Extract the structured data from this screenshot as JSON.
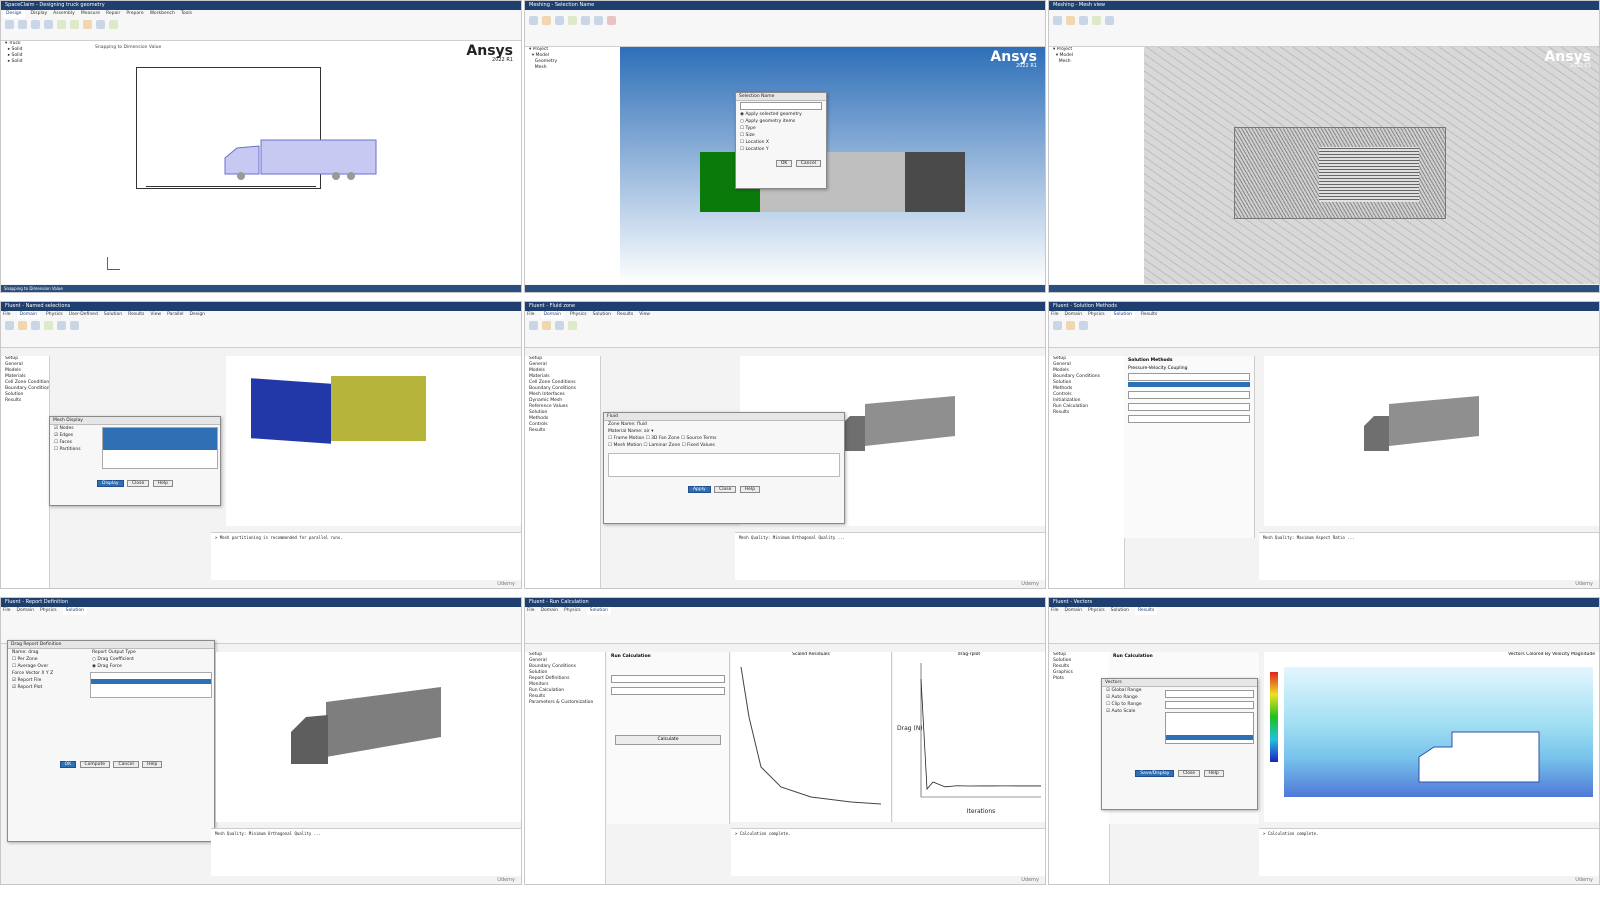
{
  "brand": {
    "name": "Ansys",
    "version": "2022 R1",
    "watermark": "Udemy"
  },
  "colors": {
    "title_bar": "#1f3f6f",
    "status_bar": "#2b4e7d",
    "selection": "#2f6fb3",
    "green_face": "#0a7a0a",
    "blue_face": "#2238a8",
    "yellow_face": "#b6b43a"
  },
  "panels": [
    {
      "id": "p1",
      "label": "SpaceClaim - Designing truck geometry",
      "status": "Snapping to Dimension Value",
      "viewport_text": "Snapping to Dimension Value"
    },
    {
      "id": "p2",
      "label": "Meshing - Selection Name",
      "dialog_title": "Selection Name",
      "dialog_ok": "OK",
      "dialog_cancel": "Cancel"
    },
    {
      "id": "p3",
      "label": "Meshing - Mesh view"
    },
    {
      "id": "p4",
      "label": "Fluent - Named selections",
      "dialog_title": "Mesh Display",
      "button_display": "Display",
      "button_close": "Close",
      "button_help": "Help"
    },
    {
      "id": "p5",
      "label": "Fluent - Fluid zone",
      "dialog_title": "Fluid",
      "button_apply": "Apply",
      "button_close": "Close",
      "button_help": "Help"
    },
    {
      "id": "p6",
      "label": "Fluent - Solution Methods",
      "panel_title": "Solution Methods",
      "item_coupling": "Pressure-Velocity Coupling"
    },
    {
      "id": "p7",
      "label": "Fluent - Report Definition",
      "dialog_title": "Drag Report Definition",
      "button_ok": "OK",
      "button_compute": "Compute",
      "button_cancel": "Cancel",
      "button_help": "Help"
    },
    {
      "id": "p8",
      "label": "Fluent - Run Calculation",
      "panel_title": "Run Calculation",
      "chart_left_title": "Scaled Residuals",
      "chart_right_title": "drag-rplot",
      "button_calculate": "Calculate"
    },
    {
      "id": "p9",
      "label": "Fluent - Vectors",
      "panel_title": "Run Calculation",
      "dialog_title": "Vectors",
      "viewport_title": "Vectors Colored By Velocity Magnitude",
      "button_save_display": "Save/Display",
      "button_close": "Close",
      "button_help": "Help"
    }
  ],
  "ribbon_tabs": [
    "File",
    "Domain",
    "Physics",
    "User-Defined",
    "Solution",
    "Results",
    "View",
    "Parallel",
    "Design"
  ],
  "spaceclaim_tabs": [
    "File",
    "Design",
    "Display",
    "Assembly",
    "Measure",
    "Facets",
    "Repair",
    "Prepare",
    "Workbench",
    "Detail",
    "Sheet Metal",
    "Tools"
  ],
  "tree_items": [
    "Setup",
    "General",
    "Models",
    "Materials",
    "Cell Zone Conditions",
    "Boundary Conditions",
    "Mesh Interfaces",
    "Dynamic Mesh",
    "Reference Values",
    "Reference Frames",
    "Named Expressions",
    "Solution",
    "Methods",
    "Controls",
    "Report Definitions",
    "Monitors",
    "Cell Registers",
    "Initialization",
    "Calculation Activities",
    "Run Calculation",
    "Results",
    "Surfaces",
    "Graphics",
    "Plots",
    "Animations",
    "Reports",
    "Parameters & Customization",
    "Simulation Reports"
  ],
  "chart_data": {
    "type": "line",
    "title": "drag-rplot",
    "xlabel": "Iterations",
    "ylabel": "Drag (N)",
    "x": [
      0,
      5,
      10,
      20,
      30,
      40,
      50,
      60,
      70,
      80,
      90,
      100
    ],
    "series": [
      {
        "values": [
          22000,
          1500,
          2800,
          1900,
          2100,
          2050,
          2080,
          2060,
          2070,
          2065,
          2068,
          2066
        ]
      }
    ],
    "ylim": [
      0,
      25000
    ],
    "xlim": [
      0,
      100
    ],
    "grid": false
  }
}
